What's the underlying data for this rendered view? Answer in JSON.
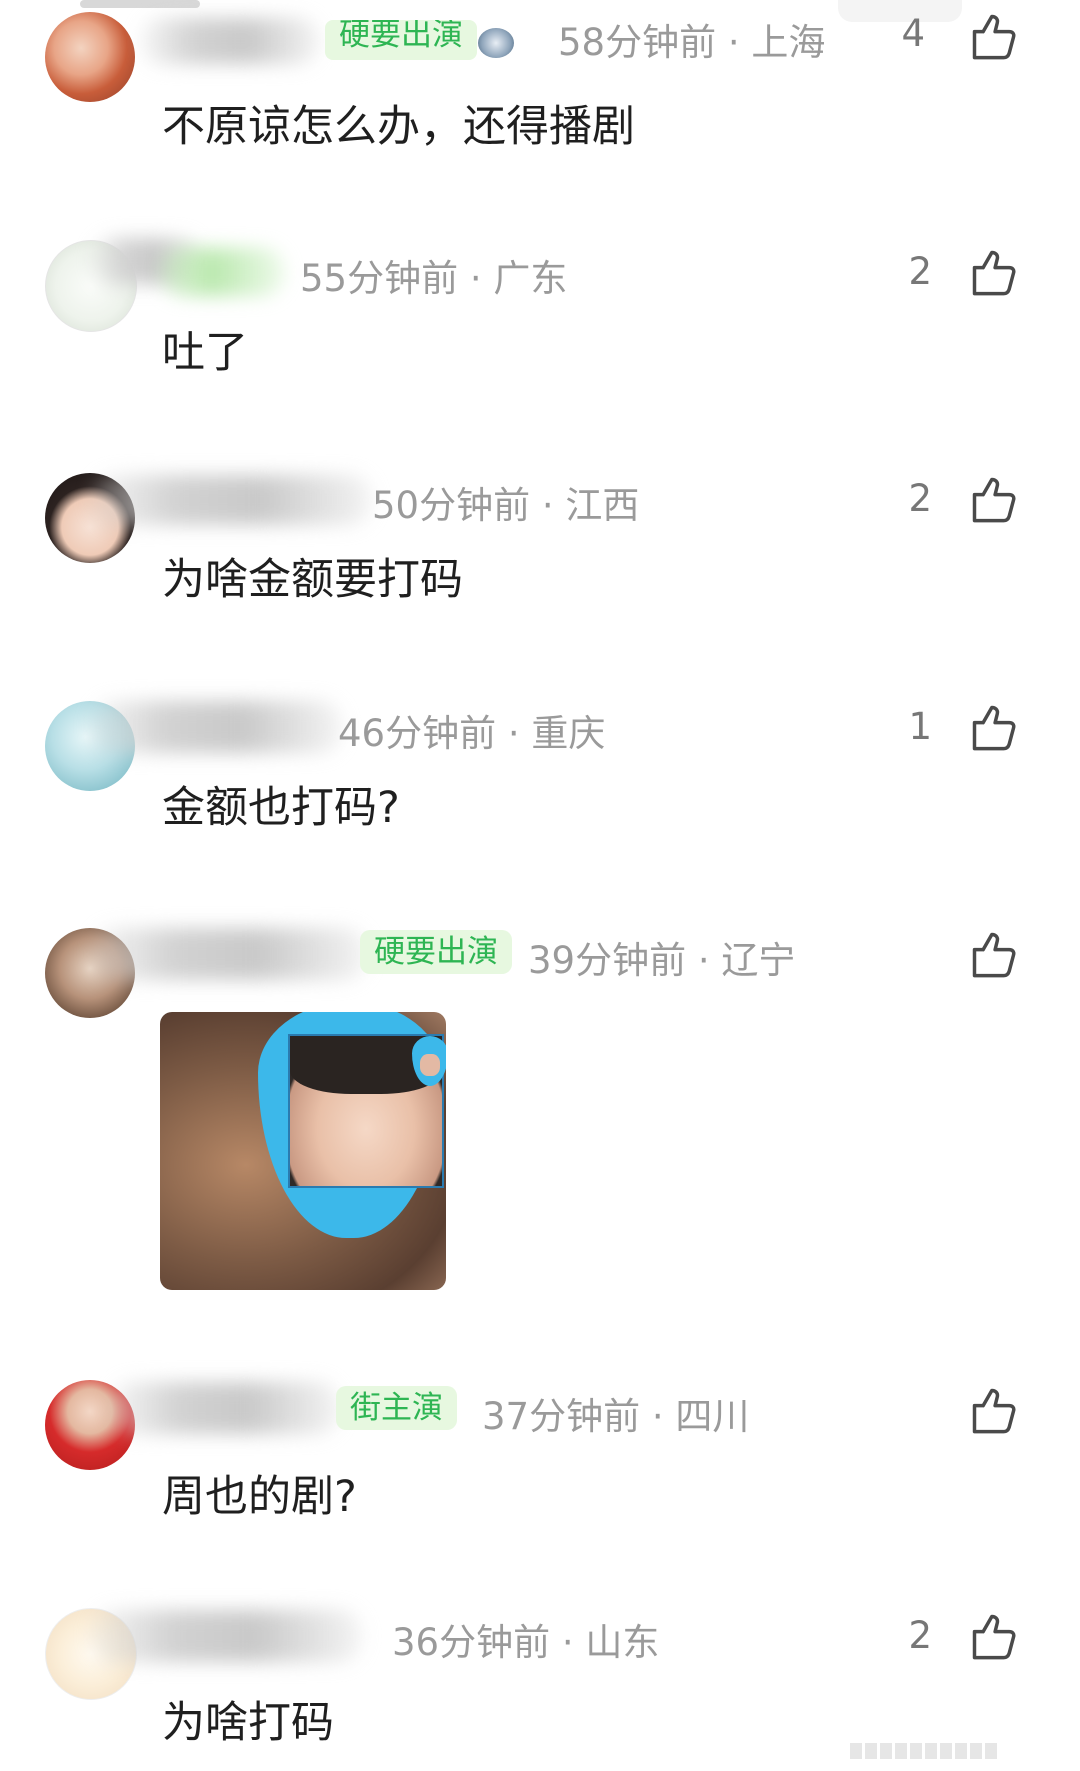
{
  "comments": [
    {
      "badge": "硬要出演",
      "time": "58分钟前",
      "location": "上海",
      "likes": "4",
      "text": "不原谅怎么办，还得播剧"
    },
    {
      "badge": "",
      "time": "55分钟前",
      "location": "广东",
      "likes": "2",
      "text": "吐了"
    },
    {
      "badge": "",
      "time": "50分钟前",
      "location": "江西",
      "likes": "2",
      "text": "为啥金额要打码"
    },
    {
      "badge": "",
      "time": "46分钟前",
      "location": "重庆",
      "likes": "1",
      "text": "金额也打码?"
    },
    {
      "badge": "硬要出演",
      "time": "39分钟前",
      "location": "辽宁",
      "likes": "",
      "text": ""
    },
    {
      "badge": "街主演",
      "time": "37分钟前",
      "location": "四川",
      "likes": "",
      "text": "周也的剧?"
    },
    {
      "badge": "",
      "time": "36分钟前",
      "location": "山东",
      "likes": "2",
      "text": "为啥打码"
    }
  ],
  "separator": " · ",
  "icons": {
    "like": "thumbs-up-icon"
  },
  "colors": {
    "badge_green": "#2eb553",
    "meta_gray": "#9a9a9a",
    "text": "#1f1f1f",
    "drop_blue": "#3cb8ea"
  }
}
